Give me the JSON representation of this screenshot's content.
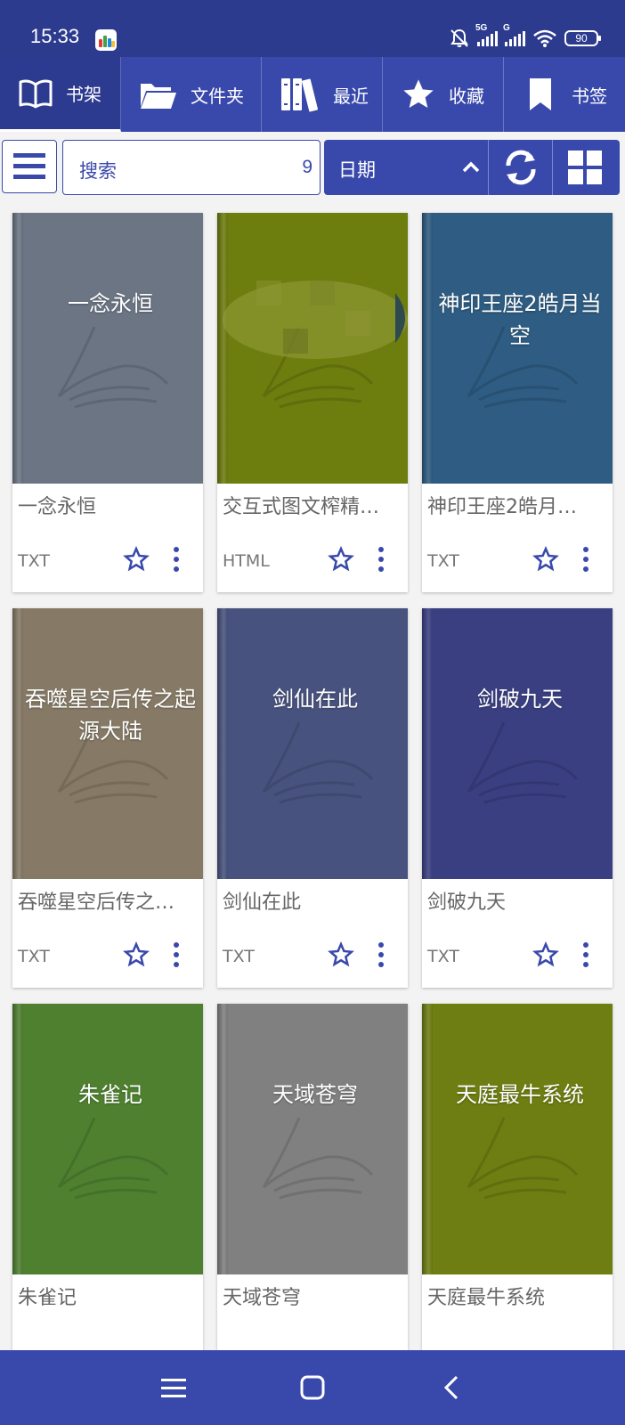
{
  "status": {
    "time": "15:33",
    "battery": "90",
    "net1": "5G",
    "net2": "G"
  },
  "tabs": [
    {
      "label": "书架",
      "icon": "book-open-icon"
    },
    {
      "label": "文件夹",
      "icon": "folder-icon"
    },
    {
      "label": "最近",
      "icon": "books-icon"
    },
    {
      "label": "收藏",
      "icon": "star-icon"
    },
    {
      "label": "书签",
      "icon": "bookmark-icon"
    }
  ],
  "search": {
    "placeholder": "搜索",
    "count": "9"
  },
  "sort": {
    "label": "日期"
  },
  "books": [
    {
      "cover_title": "一念永恒",
      "name": "一念永恒",
      "type": "TXT",
      "color": "#6b7584"
    },
    {
      "cover_title": "",
      "name": "交互式图文榨精…",
      "type": "HTML",
      "color": "#6d7d0e"
    },
    {
      "cover_title": "神印王座2皓月当空",
      "name": "神印王座2皓月…",
      "type": "TXT",
      "color": "#2e5c82"
    },
    {
      "cover_title": "吞噬星空后传之起源大陆",
      "name": "吞噬星空后传之…",
      "type": "TXT",
      "color": "#867a66"
    },
    {
      "cover_title": "剑仙在此",
      "name": "剑仙在此",
      "type": "TXT",
      "color": "#48527e"
    },
    {
      "cover_title": "剑破九天",
      "name": "剑破九天",
      "type": "TXT",
      "color": "#3a3f82"
    },
    {
      "cover_title": "朱雀记",
      "name": "朱雀记",
      "type": "",
      "color": "#4f8030"
    },
    {
      "cover_title": "天域苍穹",
      "name": "天域苍穹",
      "type": "",
      "color": "#808080"
    },
    {
      "cover_title": "天庭最牛系统",
      "name": "天庭最牛系统",
      "type": "",
      "color": "#6e7e12"
    }
  ],
  "colors": {
    "primary": "#3949ab",
    "status_bar": "#2c3b8e",
    "accent": "#3949ab"
  }
}
